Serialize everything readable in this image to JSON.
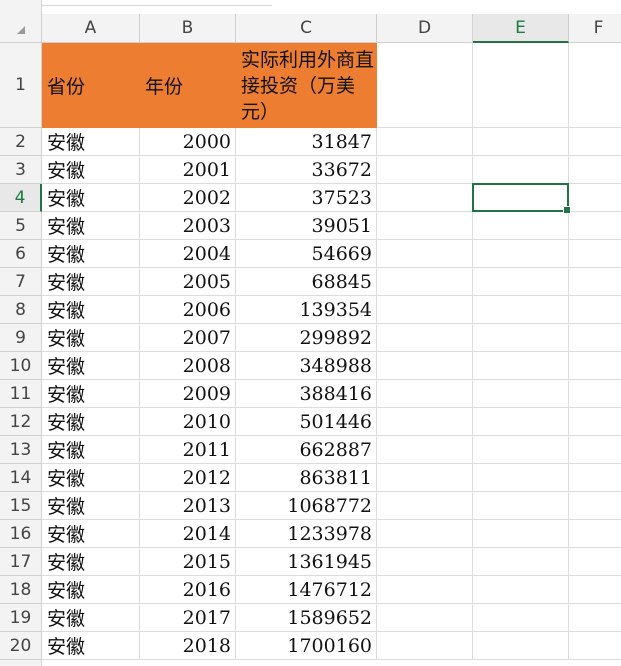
{
  "columns": [
    "A",
    "B",
    "C",
    "D",
    "E",
    "F"
  ],
  "selected_column": "E",
  "selected_row": "4",
  "header_row": {
    "row_label": "1",
    "province": "省份",
    "year": "年份",
    "fdi": "实际利用外商直接投资（万美元）"
  },
  "rows": [
    {
      "n": "2",
      "province": "安徽",
      "year": "2000",
      "value": "31847"
    },
    {
      "n": "3",
      "province": "安徽",
      "year": "2001",
      "value": "33672"
    },
    {
      "n": "4",
      "province": "安徽",
      "year": "2002",
      "value": "37523"
    },
    {
      "n": "5",
      "province": "安徽",
      "year": "2003",
      "value": "39051"
    },
    {
      "n": "6",
      "province": "安徽",
      "year": "2004",
      "value": "54669"
    },
    {
      "n": "7",
      "province": "安徽",
      "year": "2005",
      "value": "68845"
    },
    {
      "n": "8",
      "province": "安徽",
      "year": "2006",
      "value": "139354"
    },
    {
      "n": "9",
      "province": "安徽",
      "year": "2007",
      "value": "299892"
    },
    {
      "n": "10",
      "province": "安徽",
      "year": "2008",
      "value": "348988"
    },
    {
      "n": "11",
      "province": "安徽",
      "year": "2009",
      "value": "388416"
    },
    {
      "n": "12",
      "province": "安徽",
      "year": "2010",
      "value": "501446"
    },
    {
      "n": "13",
      "province": "安徽",
      "year": "2011",
      "value": "662887"
    },
    {
      "n": "14",
      "province": "安徽",
      "year": "2012",
      "value": "863811"
    },
    {
      "n": "15",
      "province": "安徽",
      "year": "2013",
      "value": "1068772"
    },
    {
      "n": "16",
      "province": "安徽",
      "year": "2014",
      "value": "1233978"
    },
    {
      "n": "17",
      "province": "安徽",
      "year": "2015",
      "value": "1361945"
    },
    {
      "n": "18",
      "province": "安徽",
      "year": "2016",
      "value": "1476712"
    },
    {
      "n": "19",
      "province": "安徽",
      "year": "2017",
      "value": "1589652"
    },
    {
      "n": "20",
      "province": "安徽",
      "year": "2018",
      "value": "1700160"
    }
  ],
  "colors": {
    "header_fill": "#ed7d31",
    "selection": "#217346"
  }
}
